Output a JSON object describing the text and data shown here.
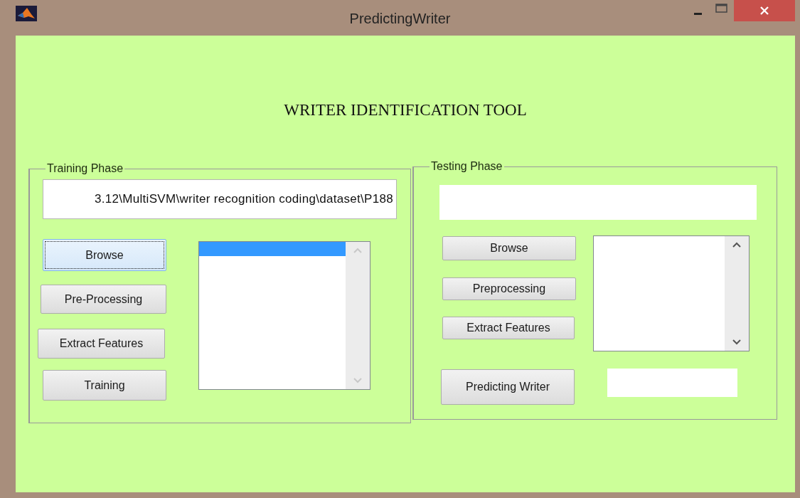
{
  "window": {
    "title": "PredictingWriter"
  },
  "heading": "WRITER IDENTIFICATION TOOL",
  "training_phase": {
    "title": "Training Phase",
    "path_field": {
      "value": "3.12\\MultiSVM\\writer recognition coding\\dataset\\P188"
    },
    "buttons": [
      {
        "label": "Browse",
        "focused": true
      },
      {
        "label": "Pre-Processing",
        "focused": false
      },
      {
        "label": "Extract Features",
        "focused": false
      },
      {
        "label": "Training",
        "focused": false
      }
    ],
    "listbox": {
      "items": [
        {
          "selected": true
        }
      ],
      "scroll_enabled": false
    }
  },
  "testing_phase": {
    "title": "Testing Phase",
    "buttons": [
      {
        "label": "Browse",
        "focused": false
      },
      {
        "label": "Preprocessing",
        "focused": false
      },
      {
        "label": "Extract Features",
        "focused": false
      },
      {
        "label": "Predicting Writer",
        "focused": false
      }
    ],
    "listbox": {
      "scroll_enabled": true
    }
  }
}
